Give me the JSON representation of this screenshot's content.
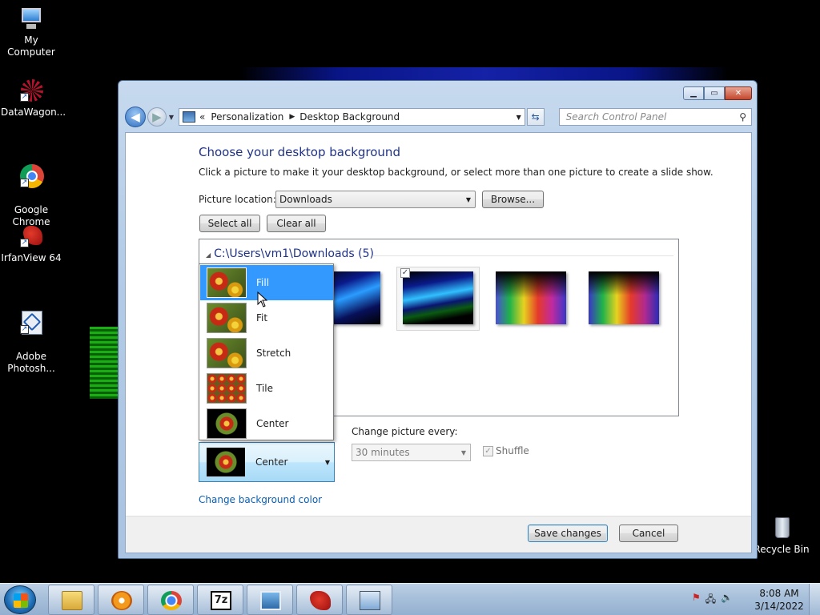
{
  "desktop": {
    "icons": [
      {
        "label": "My Computer"
      },
      {
        "label": "DataWagon..."
      },
      {
        "label": "Google\nChrome"
      },
      {
        "label": "IrfanView 64"
      },
      {
        "label": "Adobe\nPhotosh..."
      },
      {
        "label": "Recycle Bin"
      }
    ]
  },
  "window": {
    "breadcrumb": {
      "nav_prefix": "«",
      "item1": "Personalization",
      "item2": "Desktop Background"
    },
    "search_placeholder": "Search Control Panel",
    "title": "Choose your desktop background",
    "subtitle": "Click a picture to make it your desktop background, or select more than one picture to create a slide show.",
    "picture_location_label": "Picture location:",
    "picture_location_value": "Downloads",
    "browse_label": "Browse...",
    "select_all_label": "Select all",
    "clear_all_label": "Clear all",
    "folder_label": "C:\\Users\\vm1\\Downloads (5)",
    "position_options": [
      "Fill",
      "Fit",
      "Stretch",
      "Tile",
      "Center"
    ],
    "position_selected": "Center",
    "change_every_label": "Change picture every:",
    "change_every_value": "30 minutes",
    "shuffle_label": "Shuffle",
    "change_color_link": "Change background color",
    "save_label": "Save changes",
    "cancel_label": "Cancel"
  },
  "taskbar": {
    "time": "8:08 AM",
    "date": "3/14/2022",
    "apps": [
      "folder-icon",
      "media-player-icon",
      "chrome-icon",
      "7zip-icon",
      "photo-viewer-icon",
      "irfanview-icon",
      "control-panel-icon"
    ]
  }
}
